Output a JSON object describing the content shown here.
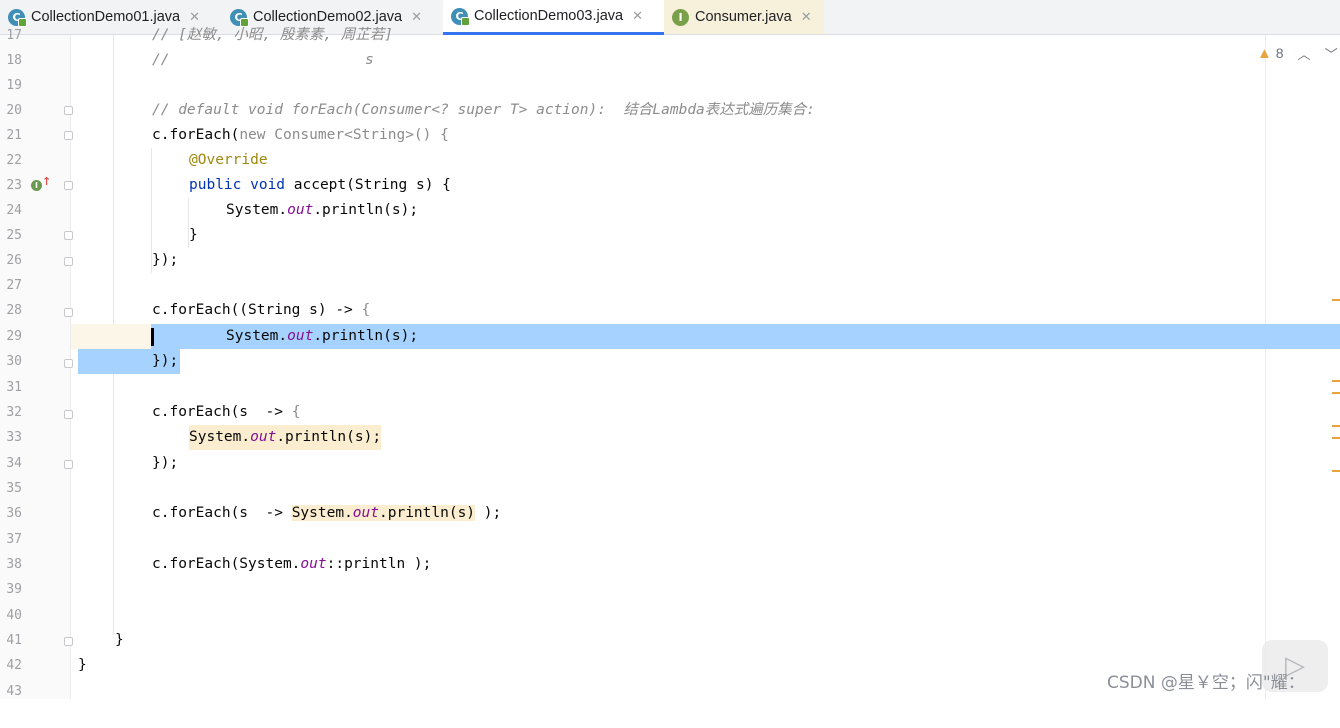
{
  "tabs": [
    {
      "label": "CollectionDemo01.java",
      "icon": "java-class-icon",
      "active": false
    },
    {
      "label": "CollectionDemo02.java",
      "icon": "java-class-icon",
      "active": false
    },
    {
      "label": "CollectionDemo03.java",
      "icon": "java-class-icon",
      "active": true
    },
    {
      "label": "Consumer.java",
      "icon": "java-interface-icon",
      "active": false
    }
  ],
  "tab_close_glyph": "✕",
  "class_icon_letter": "C",
  "interface_icon_letter": "I",
  "inspection": {
    "warning_count": "8"
  },
  "line_numbers": [
    "17",
    "18",
    "19",
    "20",
    "21",
    "22",
    "23",
    "24",
    "25",
    "26",
    "27",
    "28",
    "29",
    "30",
    "31",
    "32",
    "33",
    "34",
    "35",
    "36",
    "37",
    "38",
    "39",
    "40",
    "41",
    "42",
    "43"
  ],
  "code": {
    "l17": "// [赵敏, 小昭, 殷素素, 周芷若]",
    "l18_a": "//",
    "l18_b": "s",
    "l20_comment": "// default void forEach(Consumer<? super T> action):  结合Lambda表达式遍历集合:",
    "l21_a": "c.forEach(",
    "l21_new": "new",
    "l21_b": " Consumer<String>() {",
    "l22": "@Override",
    "l23_kw": "public void",
    "l23_b": " accept(String s) {",
    "l24_a": "System.",
    "l24_out": "out",
    "l24_b": ".println(s);",
    "l25": "}",
    "l26": "});",
    "l28_a": "c.forEach((String s) -> ",
    "l28_brace": "{",
    "l29_a": "System.",
    "l29_out": "out",
    "l29_b": ".println(s);",
    "l30": "});",
    "l32_a": "c.forEach(s  -> ",
    "l32_brace": "{",
    "l33_a": "System.",
    "l33_out": "out",
    "l33_b": ".println(s);",
    "l34": "});",
    "l36_a": "c.forEach(s  -> ",
    "l36_hl_a": "System.",
    "l36_out": "out",
    "l36_hl_b": ".println(s)",
    "l36_c": " );",
    "l38_a": "c.forEach(System.",
    "l38_out": "out",
    "l38_b": "::println );",
    "l41": "}",
    "l42": "}"
  },
  "watermark": "CSDN @星￥空；闪\"耀："
}
